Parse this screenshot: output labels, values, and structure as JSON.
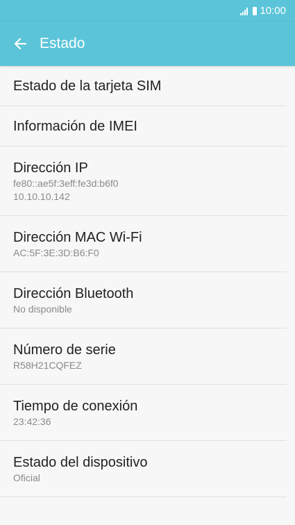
{
  "statusbar": {
    "time": "10:00"
  },
  "appbar": {
    "title": "Estado"
  },
  "items": [
    {
      "title": "Estado de la tarjeta SIM"
    },
    {
      "title": "Información de IMEI"
    },
    {
      "title": "Dirección IP",
      "sub1": "fe80::ae5f:3eff:fe3d:b6f0",
      "sub2": "10.10.10.142"
    },
    {
      "title": "Dirección MAC Wi-Fi",
      "sub1": "AC:5F:3E:3D:B6:F0"
    },
    {
      "title": "Dirección Bluetooth",
      "sub1": "No disponible"
    },
    {
      "title": "Número de serie",
      "sub1": "R58H21CQFEZ"
    },
    {
      "title": "Tiempo de conexión",
      "sub1": "23:42:36"
    },
    {
      "title": "Estado del dispositivo",
      "sub1": "Oficial"
    }
  ],
  "icons": {
    "back": "arrow-left-icon",
    "signal": "signal-icon",
    "battery": "battery-icon"
  },
  "colors": {
    "accent": "#5bc4d8",
    "background": "#f7f7f7"
  }
}
